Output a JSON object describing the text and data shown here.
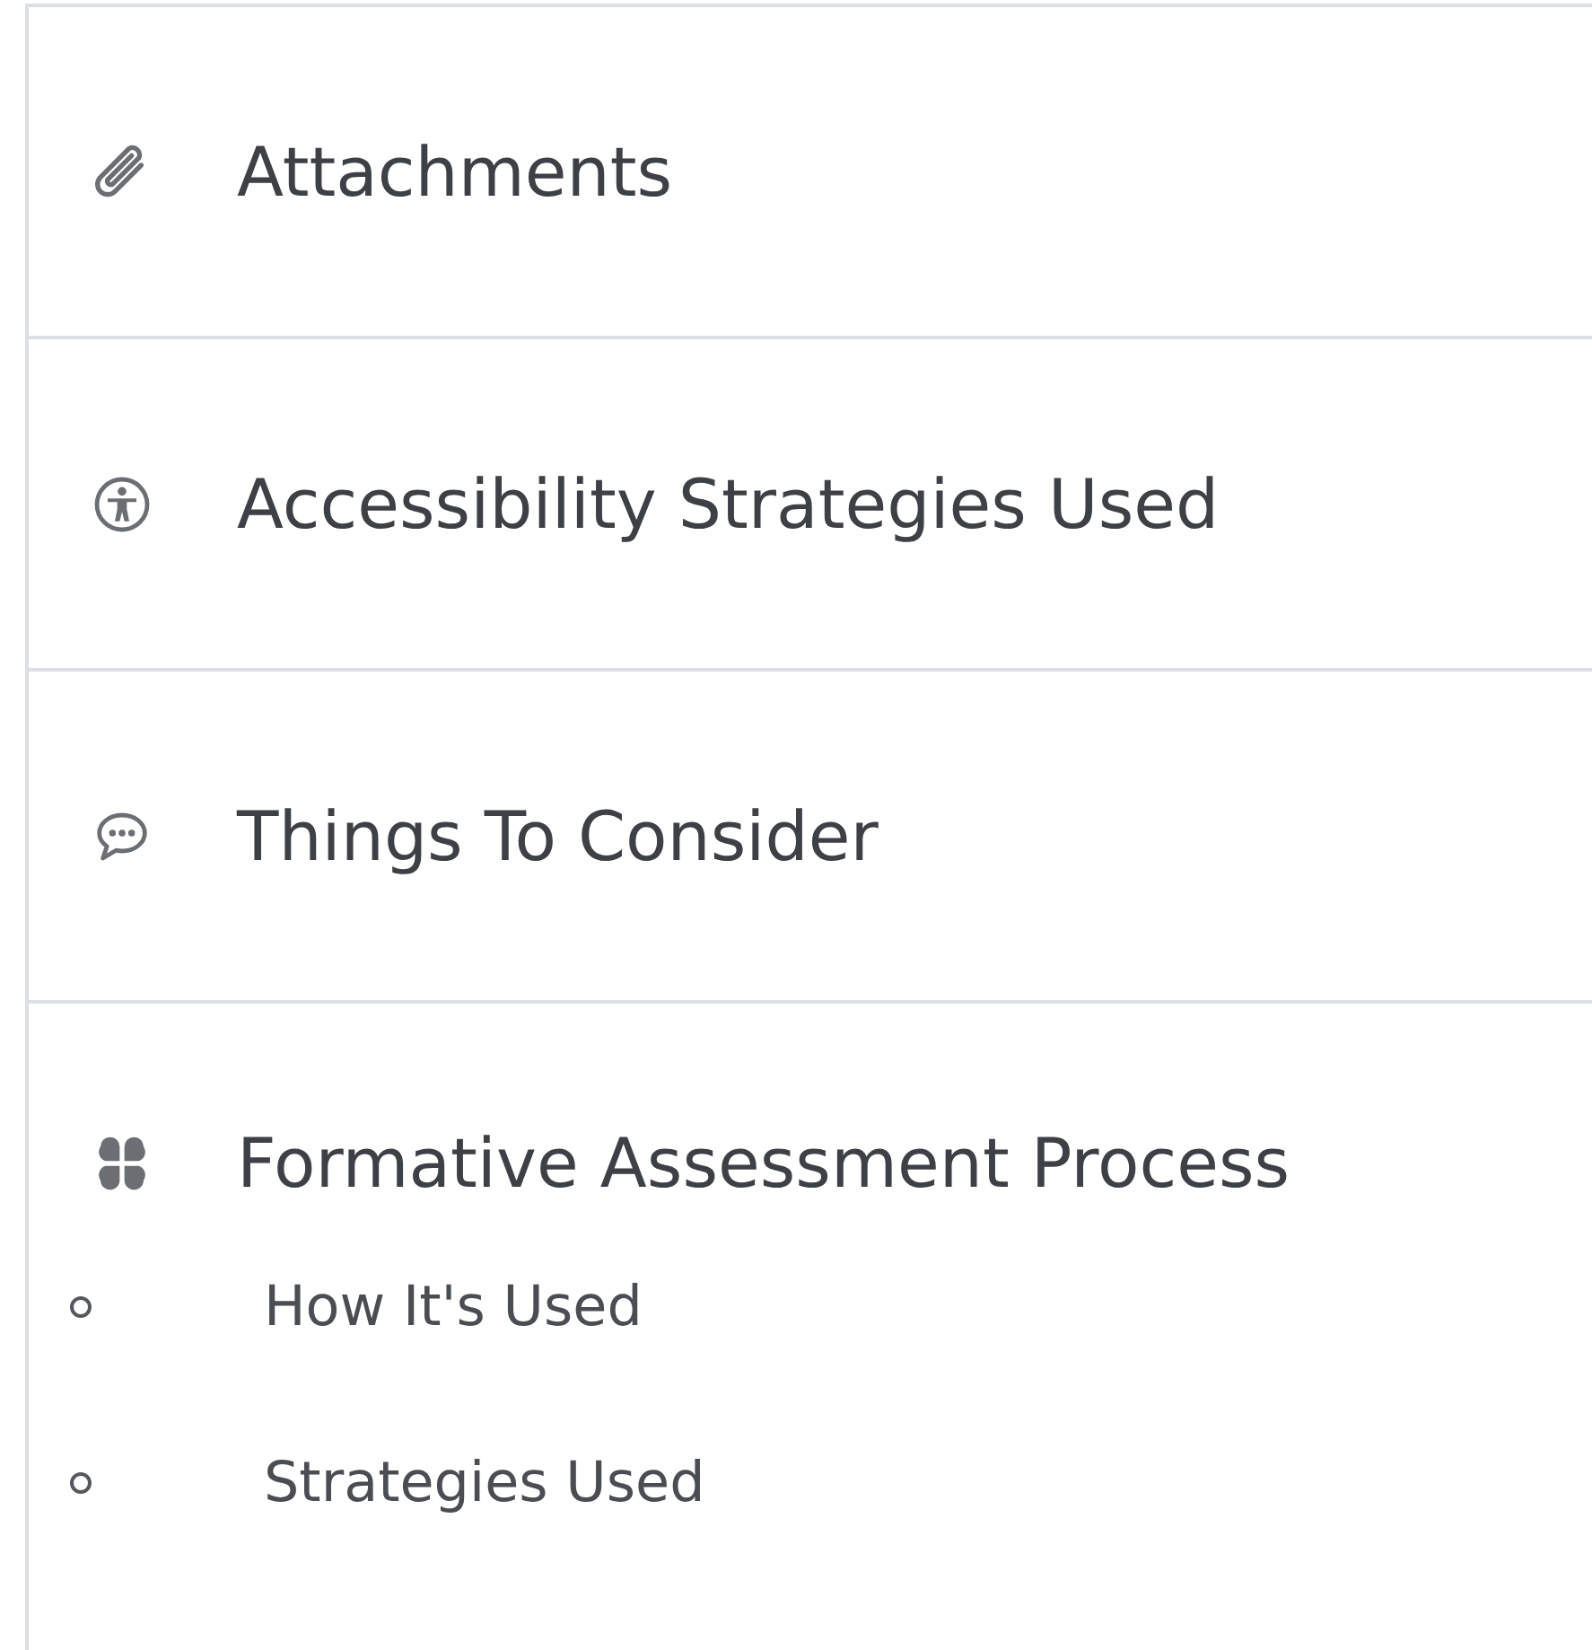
{
  "sections": [
    {
      "label": "Attachments",
      "kind": "clip"
    },
    {
      "label": "Accessibility Strategies Used",
      "kind": "figure"
    },
    {
      "label": "Things To Consider",
      "kind": "bubble"
    },
    {
      "label": "Formative Assessment Process",
      "kind": "clover",
      "children": [
        {
          "label": "How It's Used"
        },
        {
          "label": "Strategies Used"
        }
      ]
    }
  ]
}
